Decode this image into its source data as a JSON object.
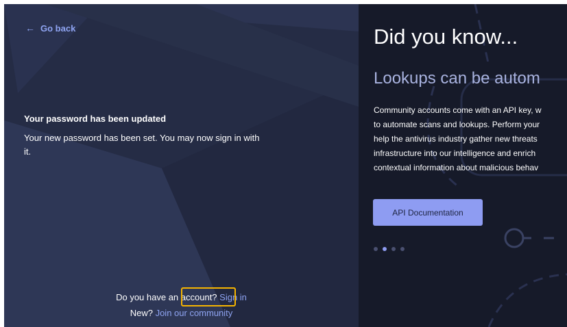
{
  "left": {
    "go_back": "Go back",
    "message_title": "Your password has been updated",
    "message_body": "Your new password has been set. You may now sign in with it.",
    "account_question": "Do you have an account?",
    "sign_in": "Sign in",
    "new_question": "New?",
    "join_link": "Join our community"
  },
  "right": {
    "title": "Did you know...",
    "subtitle": "Lookups can be autom",
    "body_lines": [
      "Community accounts come with an API key, w",
      "to automate scans and lookups. Perform your",
      "help the antivirus industry gather new threats",
      "infrastructure into our intelligence and enrich",
      "contextual information about malicious behav"
    ],
    "api_button": "API Documentation",
    "carousel": {
      "count": 4,
      "active": 2
    }
  },
  "colors": {
    "left_bg": "#252c45",
    "right_bg": "#161a29",
    "accent": "#8e9cf2",
    "link": "#8fa4f2",
    "highlight": "#f7b500"
  }
}
